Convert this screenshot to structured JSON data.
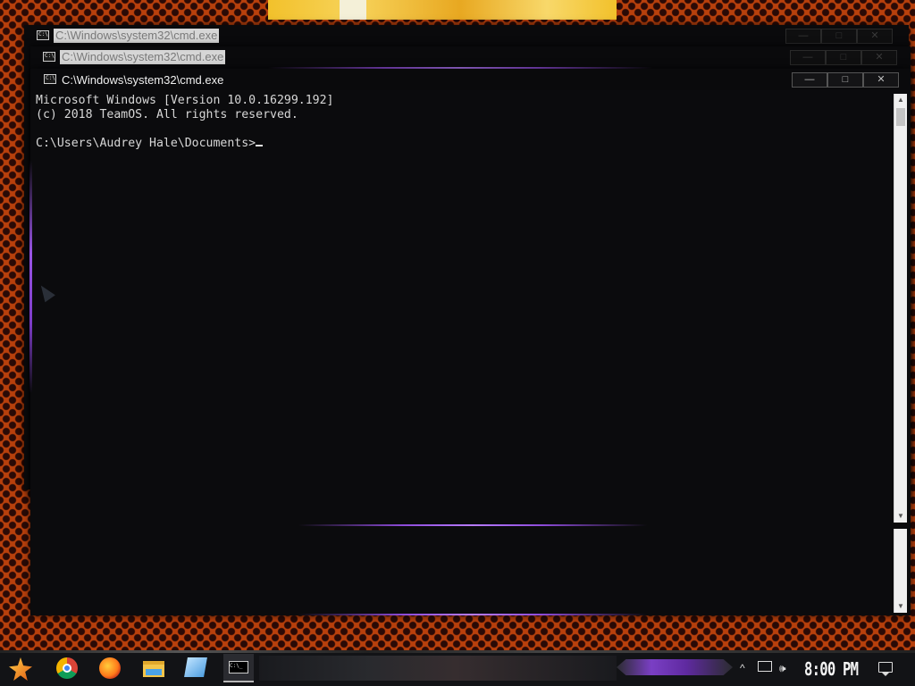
{
  "desktop": {
    "wallpaper": "orange polka-dot anime wallpaper",
    "colors": {
      "accent_purple": "#9a55e6",
      "background_orange": "#b8400c",
      "console_bg": "#0b0b0d",
      "console_text": "#d7d7d7"
    }
  },
  "windows": [
    {
      "title": "C:\\Windows\\system32\\cmd.exe",
      "state": "inactive"
    },
    {
      "title": "C:\\Windows\\system32\\cmd.exe",
      "state": "inactive"
    },
    {
      "title": "C:\\Windows\\system32\\cmd.exe",
      "state": "active"
    }
  ],
  "window_controls": {
    "minimize": "—",
    "maximize": "□",
    "close": "✕"
  },
  "console": {
    "lines": [
      "Microsoft Windows [Version 10.0.16299.192]",
      "(c) 2018 TeamOS. All rights reserved.",
      "",
      "C:\\Users\\Audrey Hale\\Documents>"
    ]
  },
  "scrollbar": {
    "up_arrow": "▲",
    "down_arrow": "▼"
  },
  "taskbar": {
    "apps": [
      {
        "name": "start",
        "icon": "start-star-icon"
      },
      {
        "name": "chrome",
        "icon": "chrome-icon"
      },
      {
        "name": "firefox",
        "icon": "firefox-icon"
      },
      {
        "name": "file-explorer",
        "icon": "folder-icon"
      },
      {
        "name": "app",
        "icon": "app-icon"
      },
      {
        "name": "command-prompt",
        "icon": "cmd-icon",
        "active": true
      }
    ],
    "tray": {
      "overflow_arrow": "^",
      "network_icon": "network-icon",
      "volume_icon": "volume-icon",
      "clock": "8:00 PM",
      "notification_icon": "action-center-icon"
    }
  }
}
